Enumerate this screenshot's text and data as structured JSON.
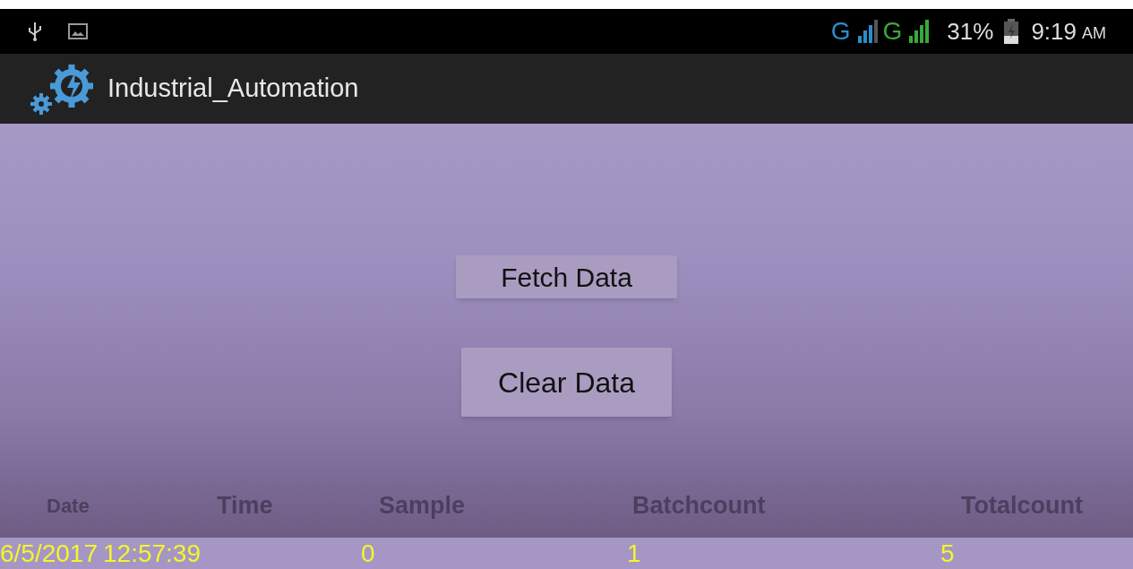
{
  "status_bar": {
    "networks": [
      {
        "label": "G",
        "color": "#2a8fc8"
      },
      {
        "label": "G",
        "color": "#3aa838"
      }
    ],
    "battery": "31%",
    "time": "9:19",
    "meridiem": "AM"
  },
  "action_bar": {
    "title": "Industrial_Automation"
  },
  "buttons": [
    {
      "label": "Fetch Data"
    },
    {
      "label": "Clear Data"
    }
  ],
  "table": {
    "columns": [
      "Date",
      "Time",
      "Sample",
      "Batchcount",
      "Totalcount"
    ],
    "rows": [
      [
        "6/5/2017",
        "12:57:39",
        "0",
        "1",
        "5"
      ]
    ]
  }
}
